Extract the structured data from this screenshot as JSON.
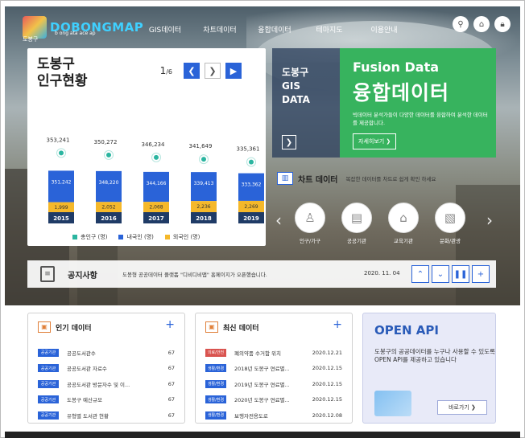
{
  "nav": {
    "logo_text": "DOBONGMAP",
    "logo_sub": "도봉구",
    "logo_tag": "b ong ata  ace ap",
    "menu": [
      "GIS데이터",
      "차트데이터",
      "융합데이터",
      "테마지도",
      "이용안내"
    ],
    "icons": [
      "search-icon",
      "home-icon",
      "lock-icon"
    ]
  },
  "population": {
    "title_line1": "도봉구",
    "title_line2": "인구현황",
    "page_current": "1",
    "page_total": "/6"
  },
  "chart_data": {
    "type": "bar",
    "categories": [
      "2015",
      "2016",
      "2017",
      "2018",
      "2019"
    ],
    "series": [
      {
        "name": "총인구 (명)",
        "values": [
          353241,
          350272,
          346234,
          341649,
          335361
        ]
      },
      {
        "name": "내국인 (명)",
        "values": [
          351242,
          348220,
          344166,
          339413,
          333362
        ]
      },
      {
        "name": "외국인 (명)",
        "values": [
          1999,
          2052,
          2068,
          2236,
          2269
        ]
      }
    ],
    "total_labels": [
      "353,241",
      "350,272",
      "346,234",
      "341,649",
      "335,361"
    ],
    "domestic_labels": [
      "351,242",
      "348,220",
      "344,166",
      "339,413",
      "333,362"
    ],
    "foreign_labels": [
      "1,999",
      "2,052",
      "2,068",
      "2,236",
      "2,269"
    ],
    "colors": {
      "total": "#2bb5a0",
      "domestic": "#2a63d8",
      "foreign": "#f5b82a",
      "year": "#1f3b66"
    }
  },
  "legend": {
    "total": "총인구 (명)",
    "domestic": "내국인 (명)",
    "foreign": "외국인 (명)"
  },
  "gis": {
    "line1": "도봉구",
    "line2": "GIS",
    "line3": "DATA"
  },
  "fusion": {
    "title_en": "Fusion Data",
    "title_ko": "융합데이터",
    "desc": "빅데이터 분석가들이 다양한 데이터를 융합하여 분석한 데이터를 제공합니다.",
    "more": "자세히보기 ❯"
  },
  "chart_section": {
    "title": "차트 데이터",
    "desc": "복잡한 데이터를 차트로 쉽게 확인 하세요",
    "items": [
      "인구/가구",
      "공공기관",
      "교육기관",
      "문화/관광"
    ]
  },
  "notice": {
    "title": "공지사항",
    "message": "도봉형 공공데이터 플랫폼 \"디비디비맵\" 홈페이지가 오픈했습니다.",
    "date": "2020. 11. 04"
  },
  "popular": {
    "title": "인기 데이터",
    "rows": [
      {
        "tag": "공공기관",
        "text": "공공도서관수",
        "n": "67"
      },
      {
        "tag": "공공기관",
        "text": "공공도서관 자료수",
        "n": "67"
      },
      {
        "tag": "공공기관",
        "text": "공공도서관 방문자수 및 이...",
        "n": "67"
      },
      {
        "tag": "공공기관",
        "text": "도봉구 예산규모",
        "n": "67"
      },
      {
        "tag": "공공기관",
        "text": "유형별 도서관 현황",
        "n": "67"
      }
    ]
  },
  "latest": {
    "title": "최신 데이터",
    "rows": [
      {
        "tag": "의료/안전",
        "text": "폐의약품 수거함 위치",
        "n": "2020.12.21"
      },
      {
        "tag": "생활/환경",
        "text": "2018년 도봉구 연료별...",
        "n": "2020.12.15"
      },
      {
        "tag": "생활/환경",
        "text": "2019년 도봉구 연료별...",
        "n": "2020.12.15"
      },
      {
        "tag": "생활/환경",
        "text": "2020년 도봉구 연료별...",
        "n": "2020.12.15"
      },
      {
        "tag": "생활/환경",
        "text": "보행자전용도로",
        "n": "2020.12.08"
      }
    ]
  },
  "openapi": {
    "title": "OPEN API",
    "desc": "도봉구의 공공데이터를 누구나 사용할 수 있도록 OPEN API를 제공하고 있습니다",
    "button": "바로가기 ❯"
  }
}
